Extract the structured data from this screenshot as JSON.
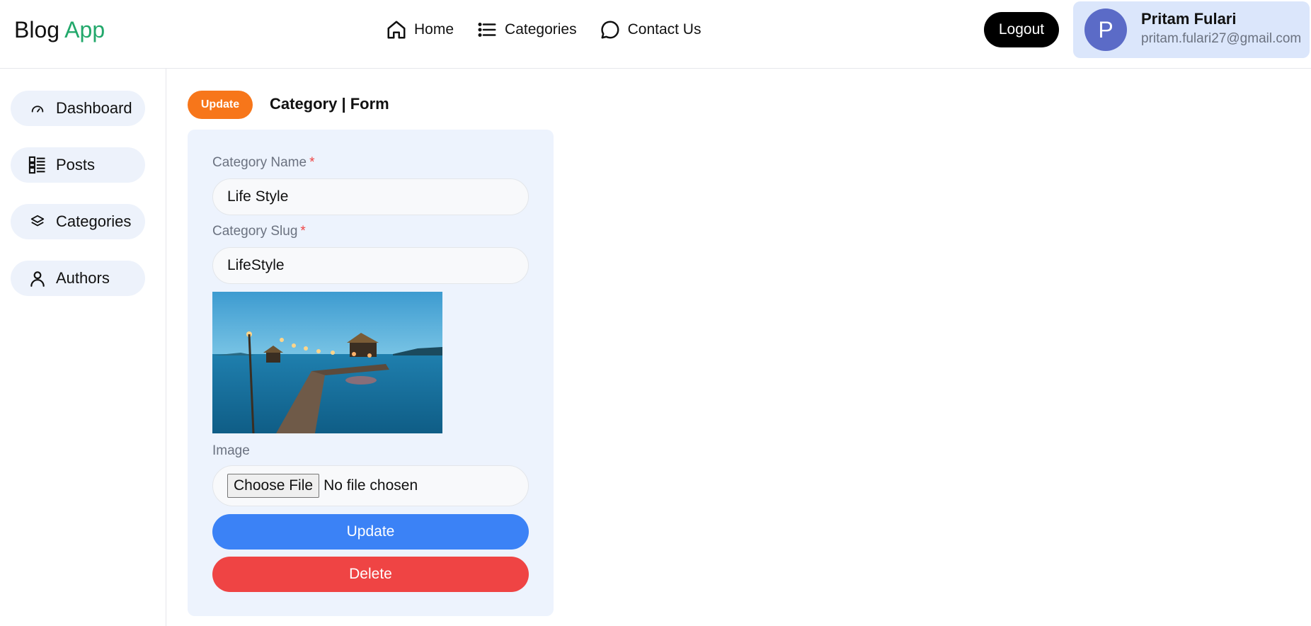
{
  "brand": {
    "part1": "Blog",
    "part2": "App"
  },
  "nav": {
    "home": "Home",
    "categories": "Categories",
    "contact": "Contact Us"
  },
  "header": {
    "logout_label": "Logout"
  },
  "user": {
    "initial": "P",
    "name": "Pritam Fulari",
    "email": "pritam.fulari27@gmail.com"
  },
  "sidebar": {
    "items": [
      {
        "label": "Dashboard",
        "icon": "gauge-icon"
      },
      {
        "label": "Posts",
        "icon": "list-icon"
      },
      {
        "label": "Categories",
        "icon": "layers-icon"
      },
      {
        "label": "Authors",
        "icon": "user-icon"
      }
    ]
  },
  "form": {
    "badge": "Update",
    "title": "Category | Form",
    "name_label": "Category Name",
    "name_value": "Life Style",
    "slug_label": "Category Slug",
    "slug_value": "LifeStyle",
    "required_mark": "*",
    "image_label": "Image",
    "file_button": "Choose File",
    "file_status": "No file chosen",
    "update_label": "Update",
    "delete_label": "Delete"
  },
  "colors": {
    "brand_accent": "#22a86b",
    "badge": "#f7761a",
    "update_button": "#3b82f6",
    "delete_button": "#ef4444",
    "avatar": "#5b6bc7"
  }
}
